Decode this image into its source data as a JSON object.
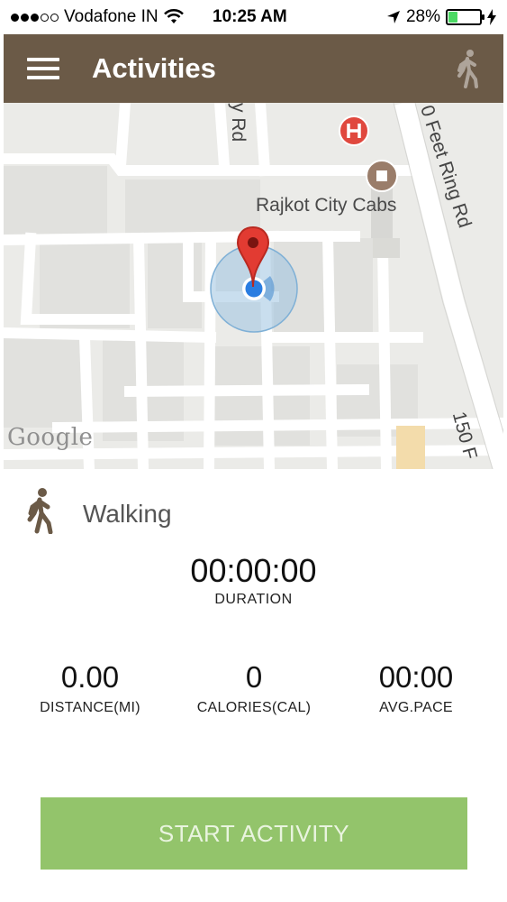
{
  "status_bar": {
    "carrier": "Vodafone IN",
    "time": "10:25 AM",
    "battery": "28%",
    "battery_level": 0.28,
    "signal_bars_filled": 3,
    "signal_bars_total": 5
  },
  "header": {
    "title": "Activities",
    "color": "#6b5a47"
  },
  "map": {
    "labels": {
      "road_top": "y Rd",
      "ring_road": "0 Feet Ring Rd",
      "poi": "Rajkot City Cabs",
      "road_bottom": "150 F"
    },
    "attribution": "Google"
  },
  "activity": {
    "type": "Walking",
    "duration": "00:00:00",
    "duration_label": "DURATION",
    "stats": [
      {
        "value": "0.00",
        "label": "DISTANCE(MI)"
      },
      {
        "value": "0",
        "label": "CALORIES(CAL)"
      },
      {
        "value": "00:00",
        "label": "AVG.PACE"
      }
    ]
  },
  "actions": {
    "start_label": "START ACTIVITY",
    "start_color": "#93c46b"
  }
}
